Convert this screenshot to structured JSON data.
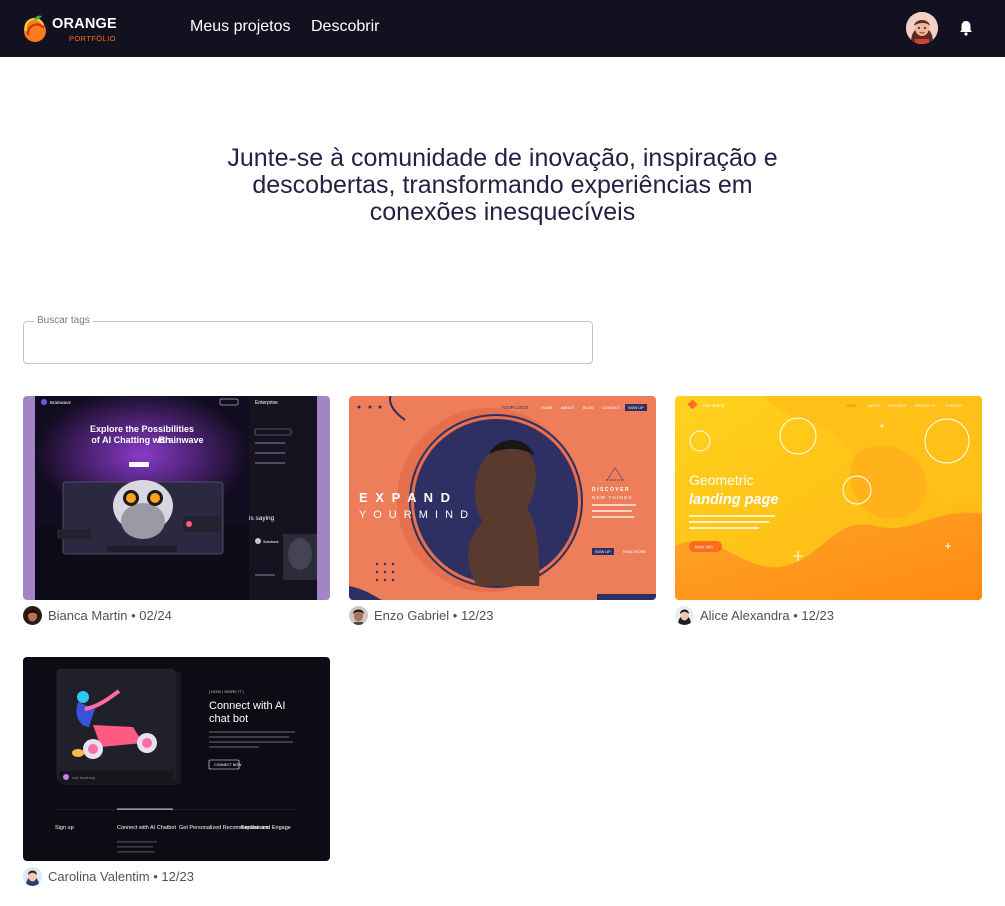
{
  "header": {
    "brand": "ORANGE",
    "brand_sub": "PORTFÓLIO",
    "nav": [
      "Meus projetos",
      "Descobrir"
    ]
  },
  "hero": {
    "text": "Junte-se à comunidade de inovação, inspiração e descobertas, transformando experiências em conexões inesquecíveis"
  },
  "search": {
    "label": "Buscar tags",
    "value": ""
  },
  "projects": [
    {
      "author": "Bianca Martin",
      "date": "02/24",
      "thumb": {
        "brand": "Brainwave",
        "headline": [
          "Explore the Possibilities",
          "of AI Chatting with",
          "Brainwave"
        ],
        "side_title": "Enterprise",
        "side_caption": "is saying",
        "side_brand": "Substrack"
      }
    },
    {
      "author": "Enzo Gabriel",
      "date": "12/23",
      "thumb": {
        "brand": "YOUR LOGO",
        "menu": [
          "HOME",
          "ABOUT",
          "BLOG",
          "CONTACT"
        ],
        "menu_button": "SIGN UP",
        "title": "E X P A N D",
        "subtitle": "Y O U R   M I N D",
        "discover": "DISCOVER",
        "discover_sub": "NEW THINGS",
        "buttons": [
          "SIGN UP",
          "READ MORE"
        ]
      }
    },
    {
      "author": "Alice Alexandra",
      "date": "12/23",
      "thumb": {
        "brand": "Your Brand",
        "menu": [
          "HOME",
          "ABOUT",
          "SERVICES",
          "PRODUCTS",
          "CONTACT"
        ],
        "title_1": "Geometric",
        "title_2": "landing page",
        "button": "More Info"
      }
    },
    {
      "author": "Carolina Valentim ",
      "date": "12/23",
      "thumb": {
        "tag": "[ HOW I WORK IT ]",
        "title_1": "Connect with AI",
        "title_2": "chat bot",
        "button": "CONNECT NOW",
        "input_hint": "Ask anything",
        "steps": [
          "Sign up",
          "Connect with AI Chatbot",
          "Get Personalized Recommendations",
          "Explore and Engage"
        ]
      }
    }
  ],
  "colors": {
    "header_bg": "#11111f",
    "accent": "#ff6b1f",
    "hero_text": "#222244"
  }
}
